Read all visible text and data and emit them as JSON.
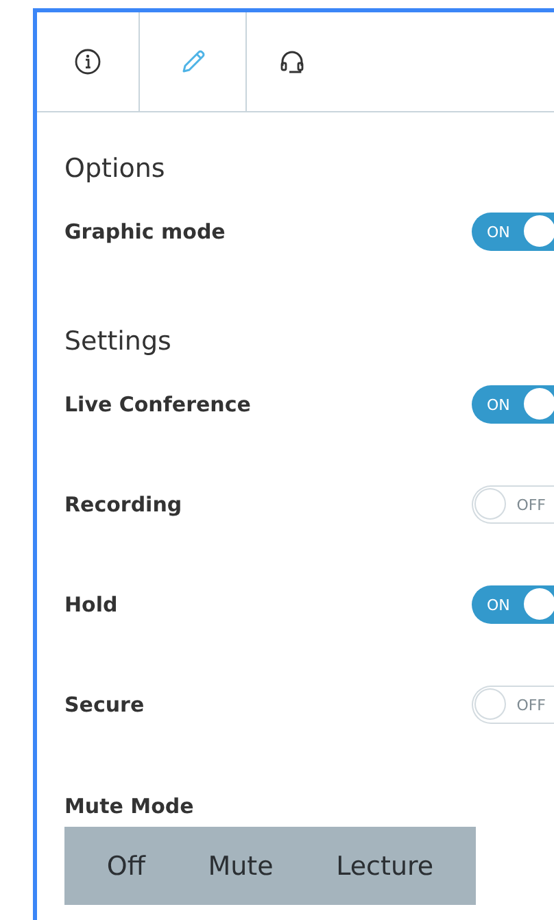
{
  "tabs": [
    {
      "kind": "info",
      "selected": false
    },
    {
      "kind": "pencil",
      "selected": true
    },
    {
      "kind": "headset",
      "selected": false
    }
  ],
  "sections": [
    {
      "title": "Options",
      "rows": [
        {
          "label": "Graphic mode",
          "on": true,
          "switch_text": "ON"
        }
      ]
    },
    {
      "title": "Settings",
      "rows": [
        {
          "label": "Live Conference",
          "on": true,
          "switch_text": "ON"
        },
        {
          "label": "Recording",
          "on": false,
          "switch_text": "OFF"
        },
        {
          "label": "Hold",
          "on": true,
          "switch_text": "ON"
        },
        {
          "label": "Secure",
          "on": false,
          "switch_text": "OFF"
        }
      ]
    }
  ],
  "mute_mode": {
    "label": "Mute Mode",
    "options": [
      "Off",
      "Mute",
      "Lecture"
    ]
  }
}
